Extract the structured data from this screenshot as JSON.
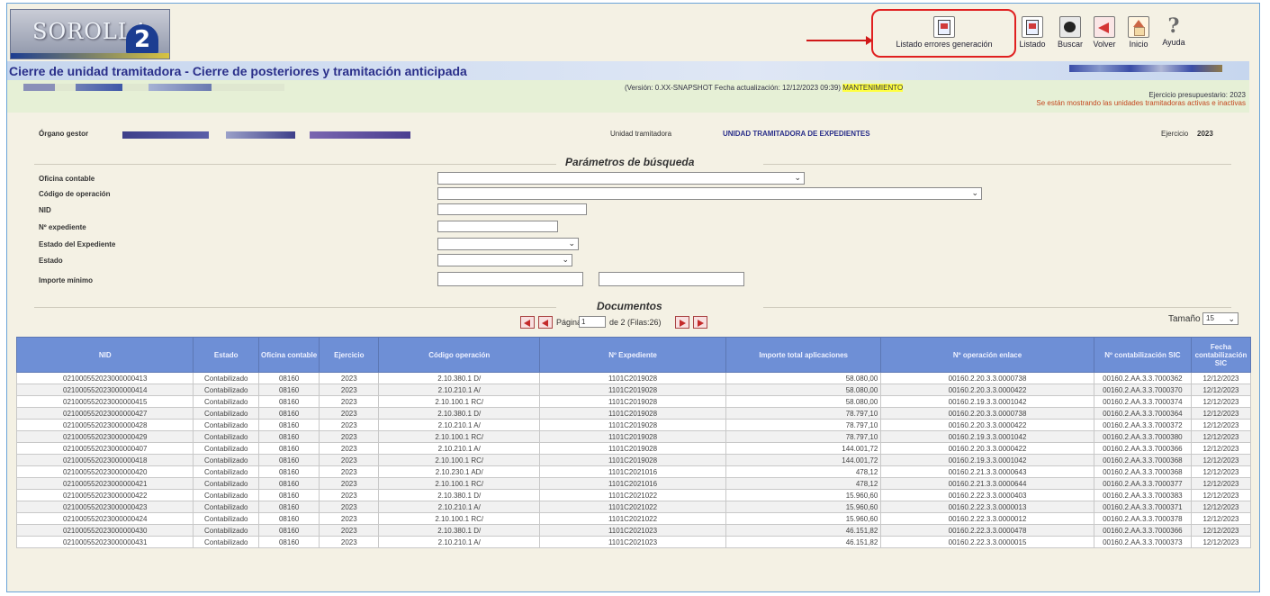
{
  "header": {
    "logo_text": "SOROLLA",
    "logo_number": "2",
    "toolbar": [
      {
        "label": "Listado errores generación",
        "icon": "listado-errores-icon"
      },
      {
        "label": "Listado",
        "icon": "listado-icon"
      },
      {
        "label": "Buscar",
        "icon": "buscar-icon"
      },
      {
        "label": "Volver",
        "icon": "volver-icon"
      },
      {
        "label": "Inicio",
        "icon": "inicio-icon"
      },
      {
        "label": "Ayuda",
        "icon": "ayuda-icon"
      }
    ]
  },
  "page_title": "Cierre de unidad tramitadora - Cierre de posteriores y tramitación anticipada",
  "info": {
    "version_prefix": "(Versión: 0.XX-SNAPSHOT Fecha actualización: 12/12/2023 09:39)",
    "mode": "MANTENIMIENTO",
    "ejercicio_presupuestario": "Ejercicio presupuestario: 2023",
    "warning": "Se están mostrando las unidades tramitadoras activas e inactivas"
  },
  "context": {
    "organo_label": "Órgano gestor",
    "unidad_label": "Unidad tramitadora",
    "unidad_value": "UNIDAD TRAMITADORA DE EXPEDIENTES",
    "ejercicio_label": "Ejercicio",
    "ejercicio_value": "2023"
  },
  "search": {
    "title": "Parámetros de búsqueda",
    "fields": {
      "oficina": "Oficina contable",
      "codigo": "Código de operación",
      "nid": "NID",
      "expediente": "Nº expediente",
      "estado_exp": "Estado del Expediente",
      "estado": "Estado",
      "importe": "Importe mínimo"
    }
  },
  "documents": {
    "title": "Documentos",
    "page_label": "Página",
    "page_value": "1",
    "page_info": "de 2 (Filas:26)",
    "size_label": "Tamaño",
    "size_value": "15",
    "columns": [
      "NID",
      "Estado",
      "Oficina contable",
      "Ejercicio",
      "Código operación",
      "Nº Expediente",
      "Importe total aplicaciones",
      "Nº operación enlace",
      "Nº contabilización SIC",
      "Fecha contabilización SIC"
    ],
    "rows": [
      [
        "021000552023000000413",
        "Contabilizado",
        "08160",
        "2023",
        "2.10.380.1 D/",
        "1101C2019028",
        "58.080,00",
        "00160.2.20.3.3.0000738",
        "00160.2.AA.3.3.7000362",
        "12/12/2023"
      ],
      [
        "021000552023000000414",
        "Contabilizado",
        "08160",
        "2023",
        "2.10.210.1 A/",
        "1101C2019028",
        "58.080,00",
        "00160.2.20.3.3.0000422",
        "00160.2.AA.3.3.7000370",
        "12/12/2023"
      ],
      [
        "021000552023000000415",
        "Contabilizado",
        "08160",
        "2023",
        "2.10.100.1 RC/",
        "1101C2019028",
        "58.080,00",
        "00160.2.19.3.3.0001042",
        "00160.2.AA.3.3.7000374",
        "12/12/2023"
      ],
      [
        "021000552023000000427",
        "Contabilizado",
        "08160",
        "2023",
        "2.10.380.1 D/",
        "1101C2019028",
        "78.797,10",
        "00160.2.20.3.3.0000738",
        "00160.2.AA.3.3.7000364",
        "12/12/2023"
      ],
      [
        "021000552023000000428",
        "Contabilizado",
        "08160",
        "2023",
        "2.10.210.1 A/",
        "1101C2019028",
        "78.797,10",
        "00160.2.20.3.3.0000422",
        "00160.2.AA.3.3.7000372",
        "12/12/2023"
      ],
      [
        "021000552023000000429",
        "Contabilizado",
        "08160",
        "2023",
        "2.10.100.1 RC/",
        "1101C2019028",
        "78.797,10",
        "00160.2.19.3.3.0001042",
        "00160.2.AA.3.3.7000380",
        "12/12/2023"
      ],
      [
        "021000552023000000407",
        "Contabilizado",
        "08160",
        "2023",
        "2.10.210.1 A/",
        "1101C2019028",
        "144.001,72",
        "00160.2.20.3.3.0000422",
        "00160.2.AA.3.3.7000366",
        "12/12/2023"
      ],
      [
        "021000552023000000418",
        "Contabilizado",
        "08160",
        "2023",
        "2.10.100.1 RC/",
        "1101C2019028",
        "144.001,72",
        "00160.2.19.3.3.0001042",
        "00160.2.AA.3.3.7000368",
        "12/12/2023"
      ],
      [
        "021000552023000000420",
        "Contabilizado",
        "08160",
        "2023",
        "2.10.230.1 AD/",
        "1101C2021016",
        "478,12",
        "00160.2.21.3.3.0000643",
        "00160.2.AA.3.3.7000368",
        "12/12/2023"
      ],
      [
        "021000552023000000421",
        "Contabilizado",
        "08160",
        "2023",
        "2.10.100.1 RC/",
        "1101C2021016",
        "478,12",
        "00160.2.21.3.3.0000644",
        "00160.2.AA.3.3.7000377",
        "12/12/2023"
      ],
      [
        "021000552023000000422",
        "Contabilizado",
        "08160",
        "2023",
        "2.10.380.1 D/",
        "1101C2021022",
        "15.960,60",
        "00160.2.22.3.3.0000403",
        "00160.2.AA.3.3.7000383",
        "12/12/2023"
      ],
      [
        "021000552023000000423",
        "Contabilizado",
        "08160",
        "2023",
        "2.10.210.1 A/",
        "1101C2021022",
        "15.960,60",
        "00160.2.22.3.3.0000013",
        "00160.2.AA.3.3.7000371",
        "12/12/2023"
      ],
      [
        "021000552023000000424",
        "Contabilizado",
        "08160",
        "2023",
        "2.10.100.1 RC/",
        "1101C2021022",
        "15.960,60",
        "00160.2.22.3.3.0000012",
        "00160.2.AA.3.3.7000378",
        "12/12/2023"
      ],
      [
        "021000552023000000430",
        "Contabilizado",
        "08160",
        "2023",
        "2.10.380.1 D/",
        "1101C2021023",
        "46.151,82",
        "00160.2.22.3.3.0000478",
        "00160.2.AA.3.3.7000366",
        "12/12/2023"
      ],
      [
        "021000552023000000431",
        "Contabilizado",
        "08160",
        "2023",
        "2.10.210.1 A/",
        "1101C2021023",
        "46.151,82",
        "00160.2.22.3.3.0000015",
        "00160.2.AA.3.3.7000373",
        "12/12/2023"
      ]
    ]
  }
}
